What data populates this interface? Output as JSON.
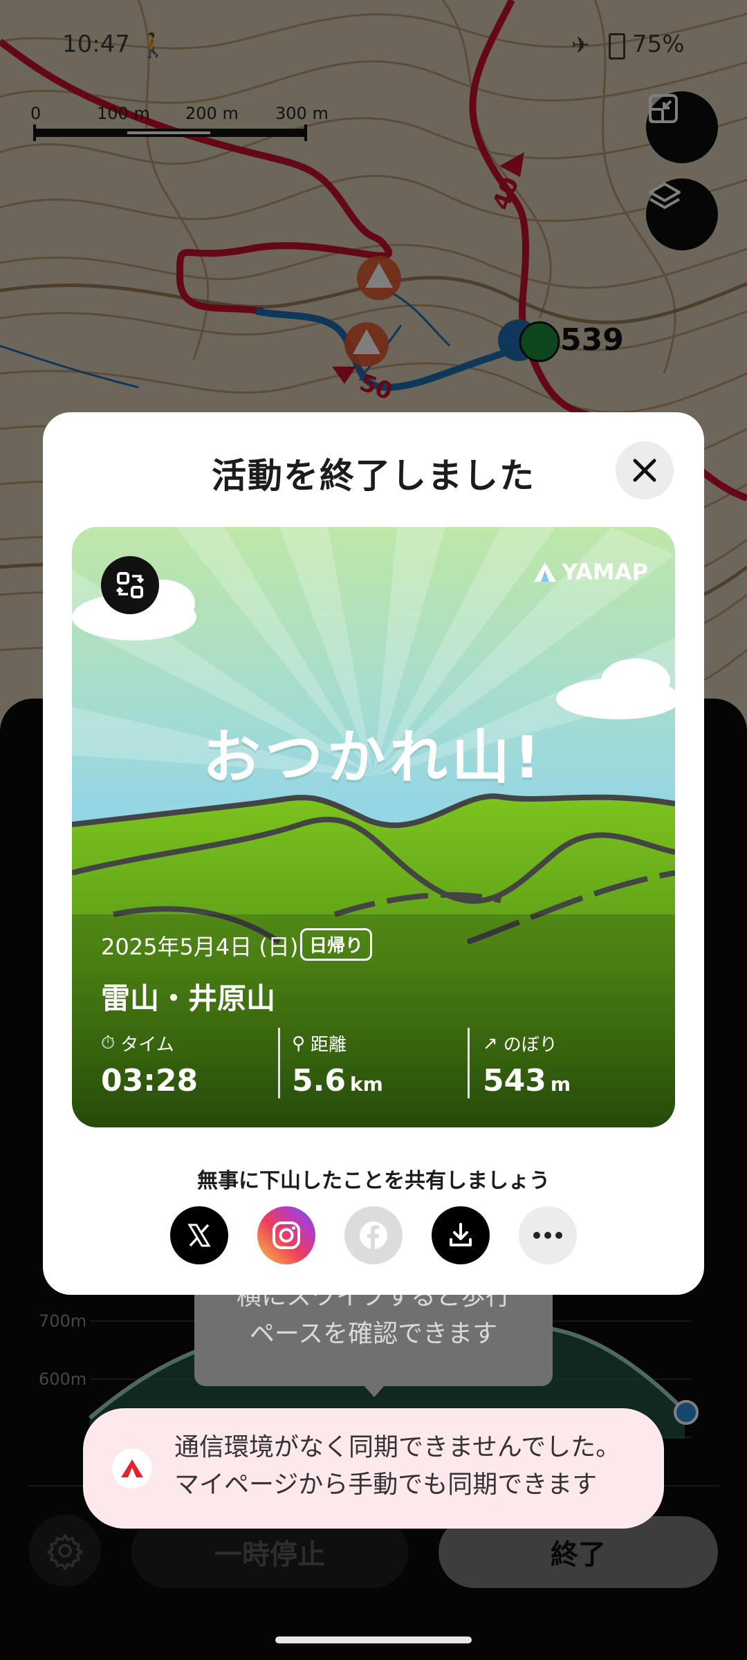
{
  "status_bar": {
    "time": "10:47",
    "battery": "75%"
  },
  "map": {
    "scale_labels": [
      "0",
      "100 m",
      "200 m",
      "300 m"
    ],
    "contour_labels": [
      "40",
      "50"
    ],
    "waypoint_number": "539"
  },
  "panel": {
    "elevation_labels": [
      "700m",
      "600m"
    ],
    "pause_label": "一時停止",
    "end_label": "終了",
    "tooltip": [
      "横にスワイプすると歩行",
      "ペースを確認できます"
    ]
  },
  "modal": {
    "title": "活動を終了しました",
    "card": {
      "brand": "YAMAP",
      "headline": "おつかれ山!",
      "date": "2025年5月4日 (日)",
      "badge": "日帰り",
      "mountain": "雷山・井原山",
      "stats": {
        "time_label": "タイム",
        "time_value": "03:28",
        "distance_label": "距離",
        "distance_value": "5.6",
        "distance_unit": "km",
        "climb_label": "のぼり",
        "climb_value": "543",
        "climb_unit": "m"
      }
    },
    "share_prompt": "無事に下山したことを共有しましょう",
    "share_buttons": [
      "x-icon",
      "instagram-icon",
      "facebook-icon",
      "download-icon",
      "more-icon"
    ]
  },
  "toast": {
    "line1": "通信環境がなく同期できませんでした。",
    "line2": "マイページから手動でも同期できます"
  },
  "colors": {
    "route_red": "#c8102e",
    "route_blue": "#1f6fb2",
    "accent_red": "#e0262c",
    "card_green": "#74c41c"
  }
}
